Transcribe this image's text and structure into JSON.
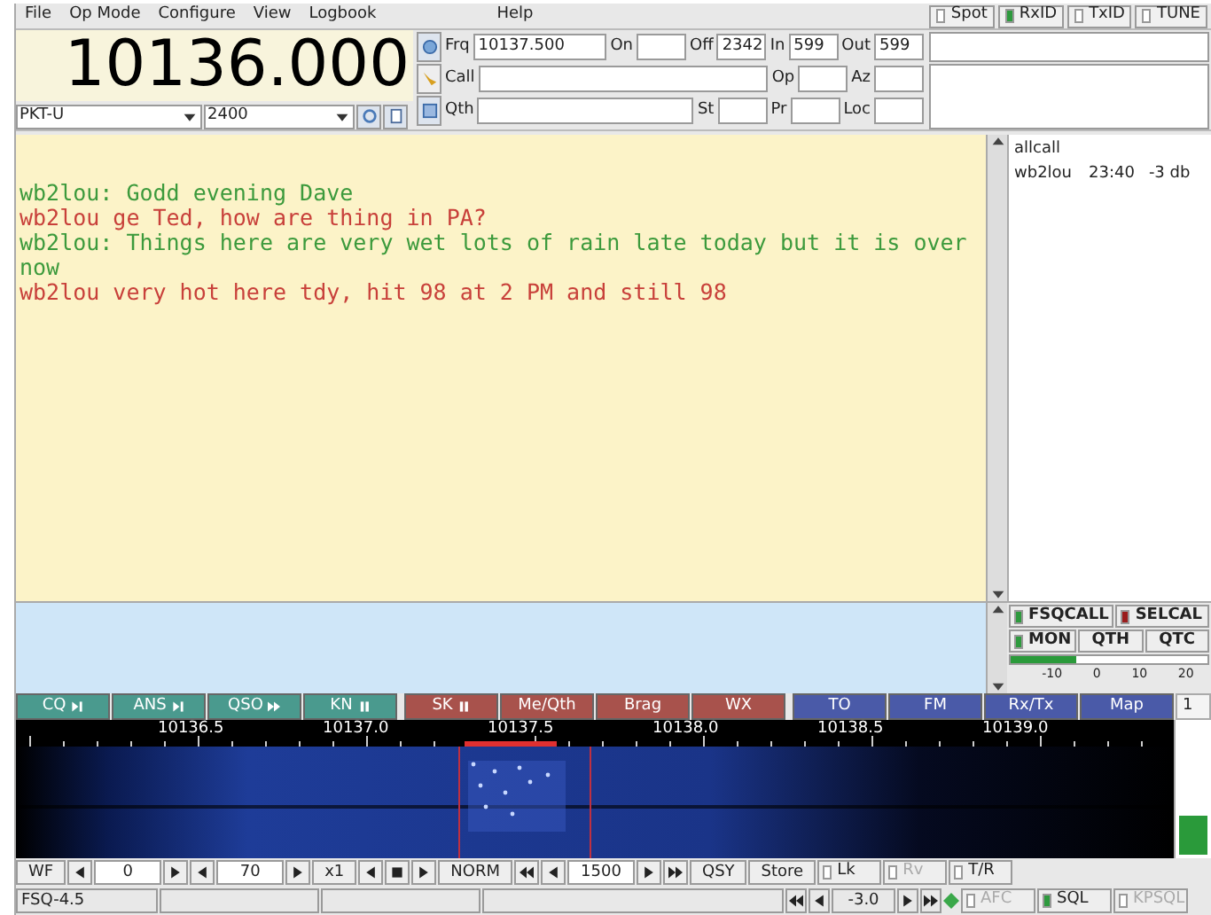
{
  "menu": [
    "File",
    "Op Mode",
    "Configure",
    "View",
    "Logbook",
    "Help"
  ],
  "indicators": [
    {
      "label": "Spot",
      "on": false
    },
    {
      "label": "RxID",
      "on": true
    },
    {
      "label": "TxID",
      "on": false
    },
    {
      "label": "TUNE",
      "on": false
    }
  ],
  "frequency": "10136.000",
  "mode": "PKT-U",
  "bandwidth": "2400",
  "log_rows": [
    [
      {
        "label": "Frq",
        "value": "10137.500"
      },
      {
        "label": "On"
      },
      {
        "label": "Off",
        "value": "2342"
      },
      {
        "label": "In",
        "value": "599"
      },
      {
        "label": "Out",
        "value": "599"
      }
    ],
    [
      {
        "label": "Call"
      },
      {
        "label": "Op"
      },
      {
        "label": "Az"
      }
    ],
    [
      {
        "label": "Qth"
      },
      {
        "label": "St"
      },
      {
        "label": "Pr"
      },
      {
        "label": "Loc"
      }
    ]
  ],
  "rx_lines": [
    {
      "text": "wb2lou: Godd evening Dave",
      "color": "#3c9a3c"
    },
    {
      "text": "wb2lou ge Ted, how are thing in PA?",
      "color": "#c8403a"
    },
    {
      "text": "wb2lou: Things here are very wet lots of rain late today but it is over now",
      "color": "#3c9a3c"
    },
    {
      "text": "wb2lou very hot here tdy, hit 98 at 2 PM and still 98",
      "color": "#c8403a"
    }
  ],
  "heard_list": {
    "header": "allcall",
    "rows": [
      {
        "call": "wb2lou",
        "time": "23:40",
        "snr": "-3 db"
      }
    ]
  },
  "fsq_buttons": [
    {
      "label": "FSQCALL",
      "on": true,
      "color": "#2e9a3e"
    },
    {
      "label": "SELCAL",
      "on": true,
      "color": "#9a1c1c"
    },
    {
      "label": "MON",
      "on": true,
      "color": "#2e9a3e"
    },
    {
      "label": "QTH"
    },
    {
      "label": "QTC"
    }
  ],
  "meter": {
    "level": 0.33,
    "ticks": [
      "-10",
      "0",
      "10",
      "20"
    ]
  },
  "macros": [
    {
      "label": "CQ",
      "kind": "next",
      "color": "#4a9a8e"
    },
    {
      "label": "ANS",
      "kind": "next",
      "color": "#4a9a8e"
    },
    {
      "label": "QSO",
      "kind": "fast",
      "color": "#4a9a8e"
    },
    {
      "label": "KN",
      "kind": "pause",
      "color": "#4a9a8e"
    },
    {
      "label": "SK",
      "kind": "pause",
      "color": "#a8524c"
    },
    {
      "label": "Me/Qth",
      "color": "#a8524c"
    },
    {
      "label": "Brag",
      "color": "#a8524c"
    },
    {
      "label": "WX",
      "color": "#a8524c"
    },
    {
      "label": "TO",
      "color": "#4a5aa8"
    },
    {
      "label": "FM",
      "color": "#4a5aa8"
    },
    {
      "label": "Rx/Tx",
      "color": "#4a5aa8"
    },
    {
      "label": "Map",
      "color": "#4a5aa8"
    }
  ],
  "macro_set": "1",
  "scale": [
    "10136.5",
    "10137.0",
    "10137.5",
    "10138.0",
    "10138.5",
    "10139.0"
  ],
  "wf_level": {
    "level": 0.3
  },
  "controls": [
    {
      "kind": "button",
      "label": "WF"
    },
    {
      "kind": "left"
    },
    {
      "kind": "value",
      "label": "0"
    },
    {
      "kind": "right"
    },
    {
      "kind": "left"
    },
    {
      "kind": "value",
      "label": "70"
    },
    {
      "kind": "right"
    },
    {
      "kind": "button",
      "label": "x1"
    },
    {
      "kind": "left"
    },
    {
      "kind": "stop"
    },
    {
      "kind": "right"
    },
    {
      "kind": "button",
      "label": "NORM"
    },
    {
      "kind": "fastleft"
    },
    {
      "kind": "left"
    },
    {
      "kind": "value",
      "label": "1500"
    },
    {
      "kind": "right"
    },
    {
      "kind": "fastright"
    },
    {
      "kind": "button",
      "label": "QSY"
    },
    {
      "kind": "button",
      "label": "Store"
    },
    {
      "kind": "check",
      "label": "Lk",
      "checked": false,
      "disabled": false
    },
    {
      "kind": "check",
      "label": "Rv",
      "checked": false,
      "disabled": true
    },
    {
      "kind": "check",
      "label": "T/R",
      "checked": false,
      "disabled": false
    }
  ],
  "status": {
    "mode": "FSQ-4.5",
    "squelch_value": "-3.0",
    "afc": {
      "label": "AFC",
      "on": false,
      "disabled": true
    },
    "sql": {
      "label": "SQL",
      "on": true,
      "disabled": false
    },
    "kpsql": {
      "label": "KPSQL",
      "on": false,
      "disabled": true
    }
  }
}
